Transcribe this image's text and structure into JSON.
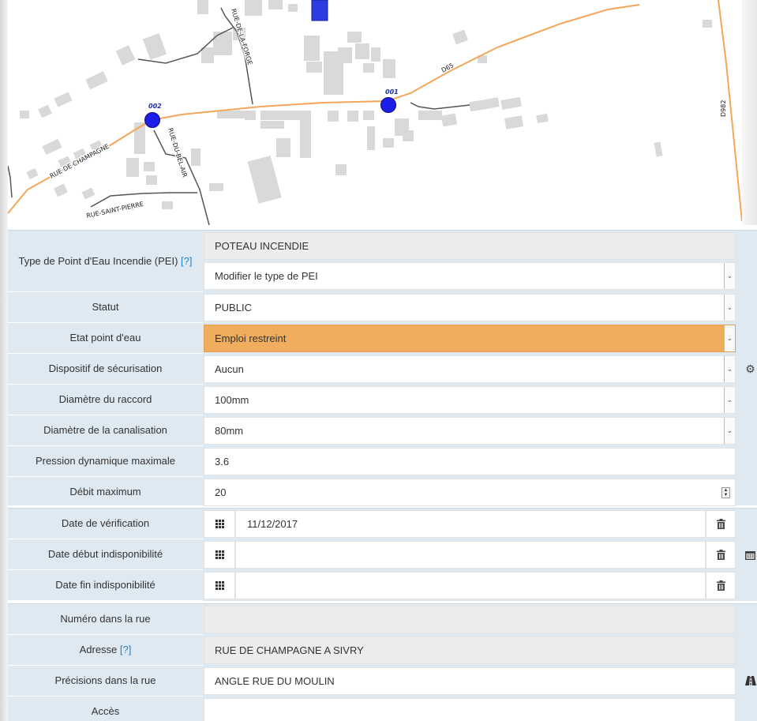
{
  "map": {
    "streets": {
      "champagne": "RUE DE CHAMPAGNE",
      "forge": "RUE-DE-LA-FORGE",
      "bel_air": "RUE-DU-BEL-AIR",
      "saint_pierre": "RUE-SAINT-PIERRE",
      "d65": "D65",
      "d982": "D982"
    },
    "points": [
      {
        "id": "002"
      },
      {
        "id": "001"
      }
    ],
    "colors": {
      "main_road": "#f4a65a",
      "point": "#1d1de8",
      "building": "#d9d9d9",
      "street": "#555555"
    }
  },
  "form": {
    "characteristics": {
      "type_label": "Type de Point d'Eau Incendie (PEI)",
      "help_link": "[?]",
      "type_value": "POTEAU INCENDIE",
      "type_select": "Modifier le type de PEI",
      "statut_label": "Statut",
      "statut_value": "PUBLIC",
      "etat_label": "Etat point d'eau",
      "etat_value": "Emploi restreint",
      "etat_color": "#f0ad5d",
      "securisation_label": "Dispositif de sécurisation",
      "securisation_value": "Aucun",
      "raccord_label": "Diamètre du raccord",
      "raccord_value": "100mm",
      "canalisation_label": "Diamètre de la canalisation",
      "canalisation_value": "80mm",
      "pression_label": "Pression dynamique maximale",
      "pression_value": "3.6",
      "debit_label": "Débit maximum",
      "debit_value": "20",
      "section_icon": "gear-icon"
    },
    "dates": {
      "verification_label": "Date de vérification",
      "verification_value": "11/12/2017",
      "debut_label": "Date début indisponibilité",
      "debut_value": "",
      "fin_label": "Date fin indisponibilité",
      "fin_value": "",
      "section_icon": "calendar-icon"
    },
    "address": {
      "numero_label": "Numéro dans la rue",
      "numero_value": "",
      "adresse_label": "Adresse",
      "help_link": "[?]",
      "adresse_value": "RUE DE CHAMPAGNE A SIVRY",
      "precisions_label": "Précisions dans la rue",
      "precisions_value": "ANGLE RUE DU MOULIN",
      "acces_label": "Accès",
      "acces_value": "",
      "section_icon": "road-icon"
    }
  }
}
